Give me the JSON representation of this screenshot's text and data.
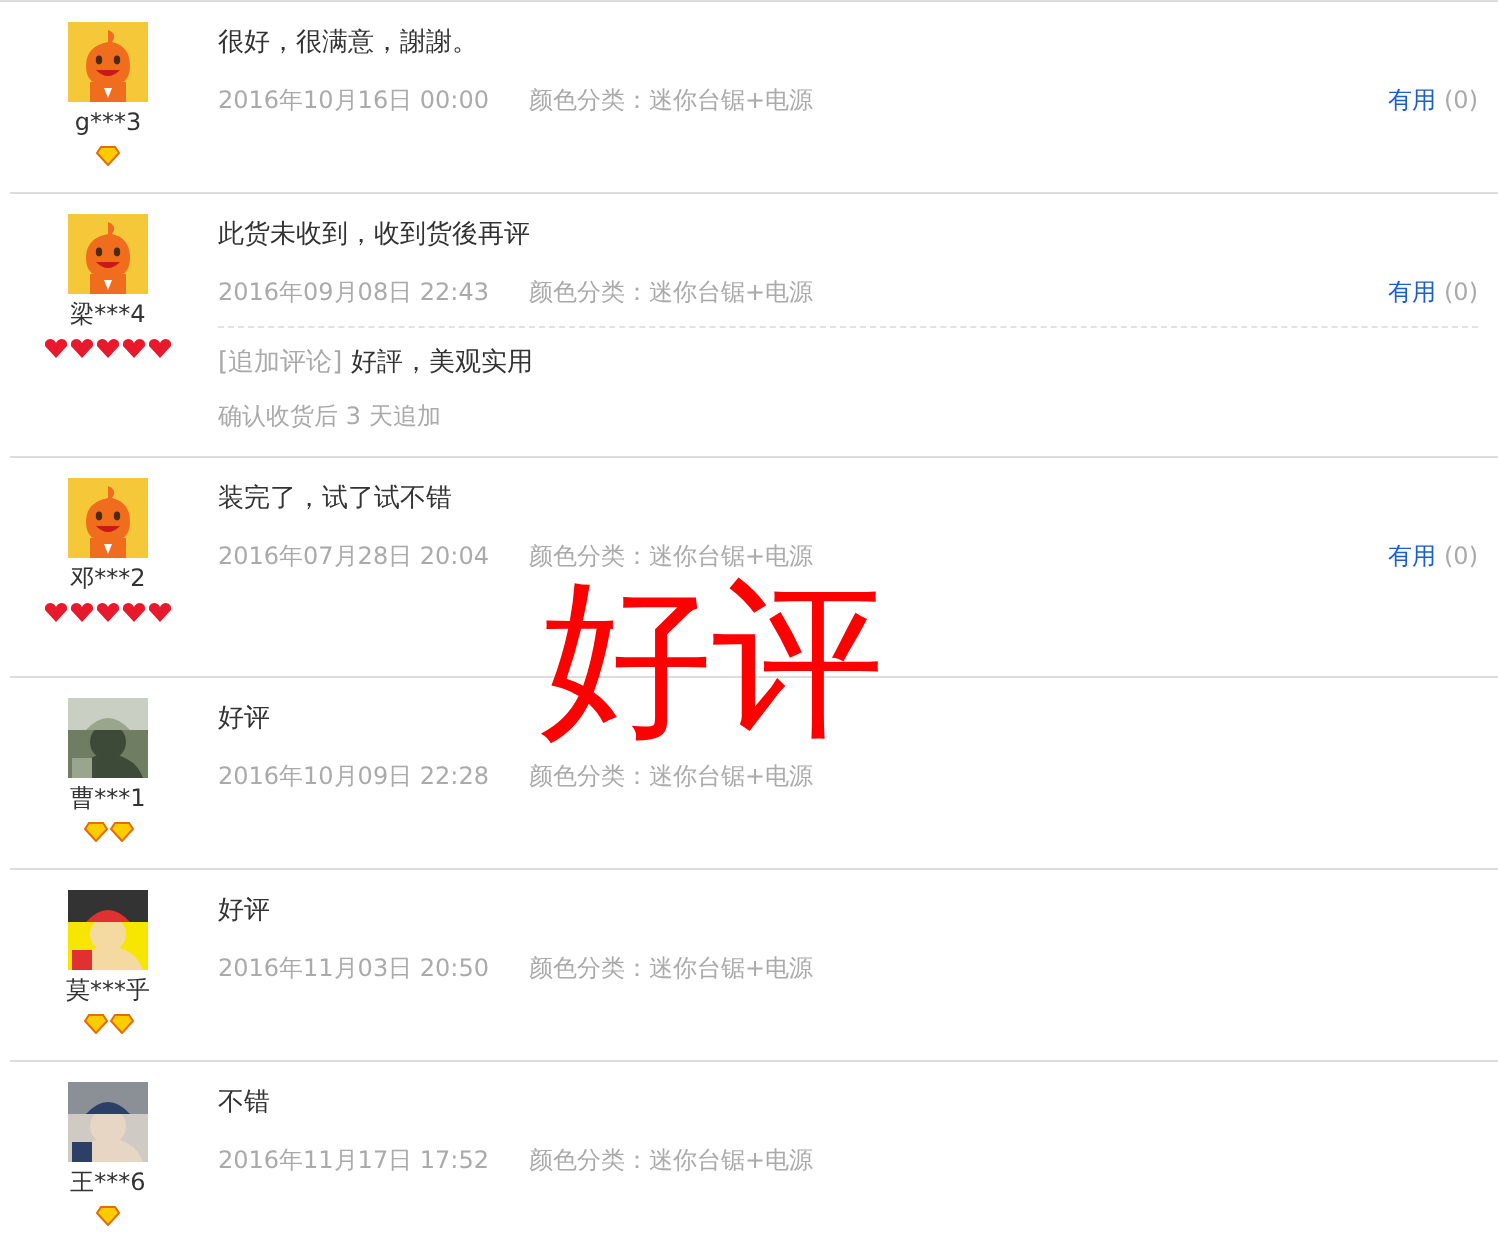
{
  "reviews": [
    {
      "avatar": {
        "kind": "mascot"
      },
      "user": "g***3",
      "rank": [
        {
          "kind": "diamond"
        }
      ],
      "text": "很好，很满意，謝謝。",
      "date": "2016年10月16日 00:00",
      "variant": "颜色分类：迷你台锯+电源",
      "useful": {
        "label": "有用",
        "count": "(0)"
      }
    },
    {
      "avatar": {
        "kind": "mascot"
      },
      "user": "梁***4",
      "rank": [
        {
          "kind": "heart"
        },
        {
          "kind": "heart"
        },
        {
          "kind": "heart"
        },
        {
          "kind": "heart"
        },
        {
          "kind": "heart"
        }
      ],
      "text": "此货未收到，收到货後再评",
      "date": "2016年09月08日 22:43",
      "variant": "颜色分类：迷你台锯+电源",
      "useful": {
        "label": "有用",
        "count": "(0)"
      },
      "followup": {
        "tag": "[追加评论]",
        "text": "好評，美观实用",
        "note": "确认收货后 3 天追加"
      }
    },
    {
      "avatar": {
        "kind": "mascot"
      },
      "user": "邓***2",
      "rank": [
        {
          "kind": "heart"
        },
        {
          "kind": "heart"
        },
        {
          "kind": "heart"
        },
        {
          "kind": "heart"
        },
        {
          "kind": "heart"
        }
      ],
      "text": "装完了，试了试不错",
      "date": "2016年07月28日 20:04",
      "variant": "颜色分类：迷你台锯+电源",
      "useful": {
        "label": "有用",
        "count": "(0)"
      }
    },
    {
      "avatar": {
        "kind": "picture"
      },
      "user": "曹***1",
      "rank": [
        {
          "kind": "diamond"
        },
        {
          "kind": "diamond"
        }
      ],
      "text": "好评",
      "date": "2016年10月09日 22:28",
      "variant": "颜色分类：迷你台锯+电源"
    },
    {
      "avatar": {
        "kind": "picture"
      },
      "user": "莫***乎",
      "rank": [
        {
          "kind": "diamond"
        },
        {
          "kind": "diamond"
        }
      ],
      "text": "好评",
      "date": "2016年11月03日 20:50",
      "variant": "颜色分类：迷你台锯+电源"
    },
    {
      "avatar": {
        "kind": "picture"
      },
      "user": "王***6",
      "rank": [
        {
          "kind": "diamond"
        }
      ],
      "text": "不错",
      "date": "2016年11月17日 17:52",
      "variant": "颜色分类：迷你台锯+电源"
    }
  ],
  "stamp": "好评"
}
